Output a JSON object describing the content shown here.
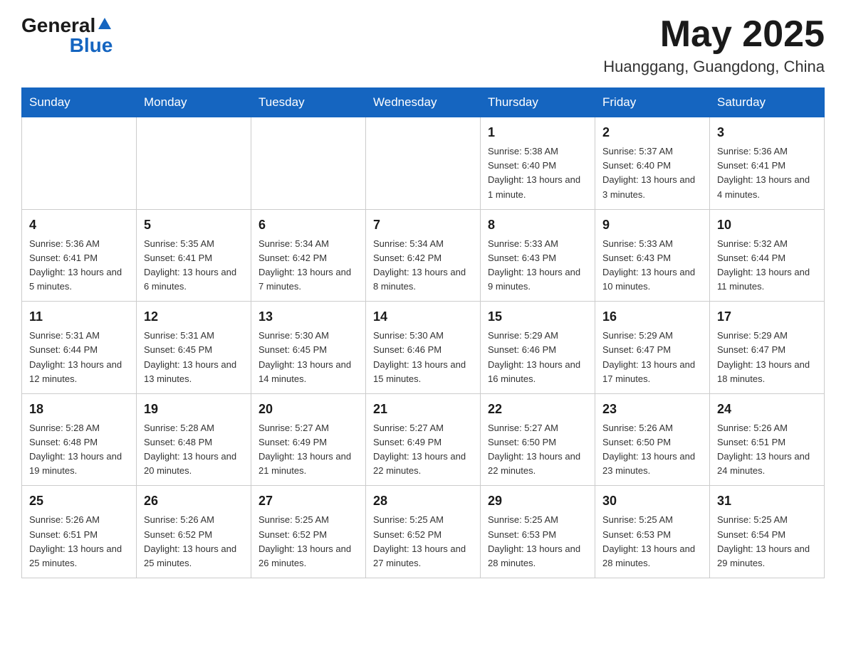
{
  "header": {
    "logo": {
      "text1": "General",
      "text2": "Blue"
    },
    "month_title": "May 2025",
    "location": "Huanggang, Guangdong, China"
  },
  "weekdays": [
    "Sunday",
    "Monday",
    "Tuesday",
    "Wednesday",
    "Thursday",
    "Friday",
    "Saturday"
  ],
  "weeks": [
    [
      {
        "day": "",
        "info": ""
      },
      {
        "day": "",
        "info": ""
      },
      {
        "day": "",
        "info": ""
      },
      {
        "day": "",
        "info": ""
      },
      {
        "day": "1",
        "info": "Sunrise: 5:38 AM\nSunset: 6:40 PM\nDaylight: 13 hours and 1 minute."
      },
      {
        "day": "2",
        "info": "Sunrise: 5:37 AM\nSunset: 6:40 PM\nDaylight: 13 hours and 3 minutes."
      },
      {
        "day": "3",
        "info": "Sunrise: 5:36 AM\nSunset: 6:41 PM\nDaylight: 13 hours and 4 minutes."
      }
    ],
    [
      {
        "day": "4",
        "info": "Sunrise: 5:36 AM\nSunset: 6:41 PM\nDaylight: 13 hours and 5 minutes."
      },
      {
        "day": "5",
        "info": "Sunrise: 5:35 AM\nSunset: 6:41 PM\nDaylight: 13 hours and 6 minutes."
      },
      {
        "day": "6",
        "info": "Sunrise: 5:34 AM\nSunset: 6:42 PM\nDaylight: 13 hours and 7 minutes."
      },
      {
        "day": "7",
        "info": "Sunrise: 5:34 AM\nSunset: 6:42 PM\nDaylight: 13 hours and 8 minutes."
      },
      {
        "day": "8",
        "info": "Sunrise: 5:33 AM\nSunset: 6:43 PM\nDaylight: 13 hours and 9 minutes."
      },
      {
        "day": "9",
        "info": "Sunrise: 5:33 AM\nSunset: 6:43 PM\nDaylight: 13 hours and 10 minutes."
      },
      {
        "day": "10",
        "info": "Sunrise: 5:32 AM\nSunset: 6:44 PM\nDaylight: 13 hours and 11 minutes."
      }
    ],
    [
      {
        "day": "11",
        "info": "Sunrise: 5:31 AM\nSunset: 6:44 PM\nDaylight: 13 hours and 12 minutes."
      },
      {
        "day": "12",
        "info": "Sunrise: 5:31 AM\nSunset: 6:45 PM\nDaylight: 13 hours and 13 minutes."
      },
      {
        "day": "13",
        "info": "Sunrise: 5:30 AM\nSunset: 6:45 PM\nDaylight: 13 hours and 14 minutes."
      },
      {
        "day": "14",
        "info": "Sunrise: 5:30 AM\nSunset: 6:46 PM\nDaylight: 13 hours and 15 minutes."
      },
      {
        "day": "15",
        "info": "Sunrise: 5:29 AM\nSunset: 6:46 PM\nDaylight: 13 hours and 16 minutes."
      },
      {
        "day": "16",
        "info": "Sunrise: 5:29 AM\nSunset: 6:47 PM\nDaylight: 13 hours and 17 minutes."
      },
      {
        "day": "17",
        "info": "Sunrise: 5:29 AM\nSunset: 6:47 PM\nDaylight: 13 hours and 18 minutes."
      }
    ],
    [
      {
        "day": "18",
        "info": "Sunrise: 5:28 AM\nSunset: 6:48 PM\nDaylight: 13 hours and 19 minutes."
      },
      {
        "day": "19",
        "info": "Sunrise: 5:28 AM\nSunset: 6:48 PM\nDaylight: 13 hours and 20 minutes."
      },
      {
        "day": "20",
        "info": "Sunrise: 5:27 AM\nSunset: 6:49 PM\nDaylight: 13 hours and 21 minutes."
      },
      {
        "day": "21",
        "info": "Sunrise: 5:27 AM\nSunset: 6:49 PM\nDaylight: 13 hours and 22 minutes."
      },
      {
        "day": "22",
        "info": "Sunrise: 5:27 AM\nSunset: 6:50 PM\nDaylight: 13 hours and 22 minutes."
      },
      {
        "day": "23",
        "info": "Sunrise: 5:26 AM\nSunset: 6:50 PM\nDaylight: 13 hours and 23 minutes."
      },
      {
        "day": "24",
        "info": "Sunrise: 5:26 AM\nSunset: 6:51 PM\nDaylight: 13 hours and 24 minutes."
      }
    ],
    [
      {
        "day": "25",
        "info": "Sunrise: 5:26 AM\nSunset: 6:51 PM\nDaylight: 13 hours and 25 minutes."
      },
      {
        "day": "26",
        "info": "Sunrise: 5:26 AM\nSunset: 6:52 PM\nDaylight: 13 hours and 25 minutes."
      },
      {
        "day": "27",
        "info": "Sunrise: 5:25 AM\nSunset: 6:52 PM\nDaylight: 13 hours and 26 minutes."
      },
      {
        "day": "28",
        "info": "Sunrise: 5:25 AM\nSunset: 6:52 PM\nDaylight: 13 hours and 27 minutes."
      },
      {
        "day": "29",
        "info": "Sunrise: 5:25 AM\nSunset: 6:53 PM\nDaylight: 13 hours and 28 minutes."
      },
      {
        "day": "30",
        "info": "Sunrise: 5:25 AM\nSunset: 6:53 PM\nDaylight: 13 hours and 28 minutes."
      },
      {
        "day": "31",
        "info": "Sunrise: 5:25 AM\nSunset: 6:54 PM\nDaylight: 13 hours and 29 minutes."
      }
    ]
  ]
}
